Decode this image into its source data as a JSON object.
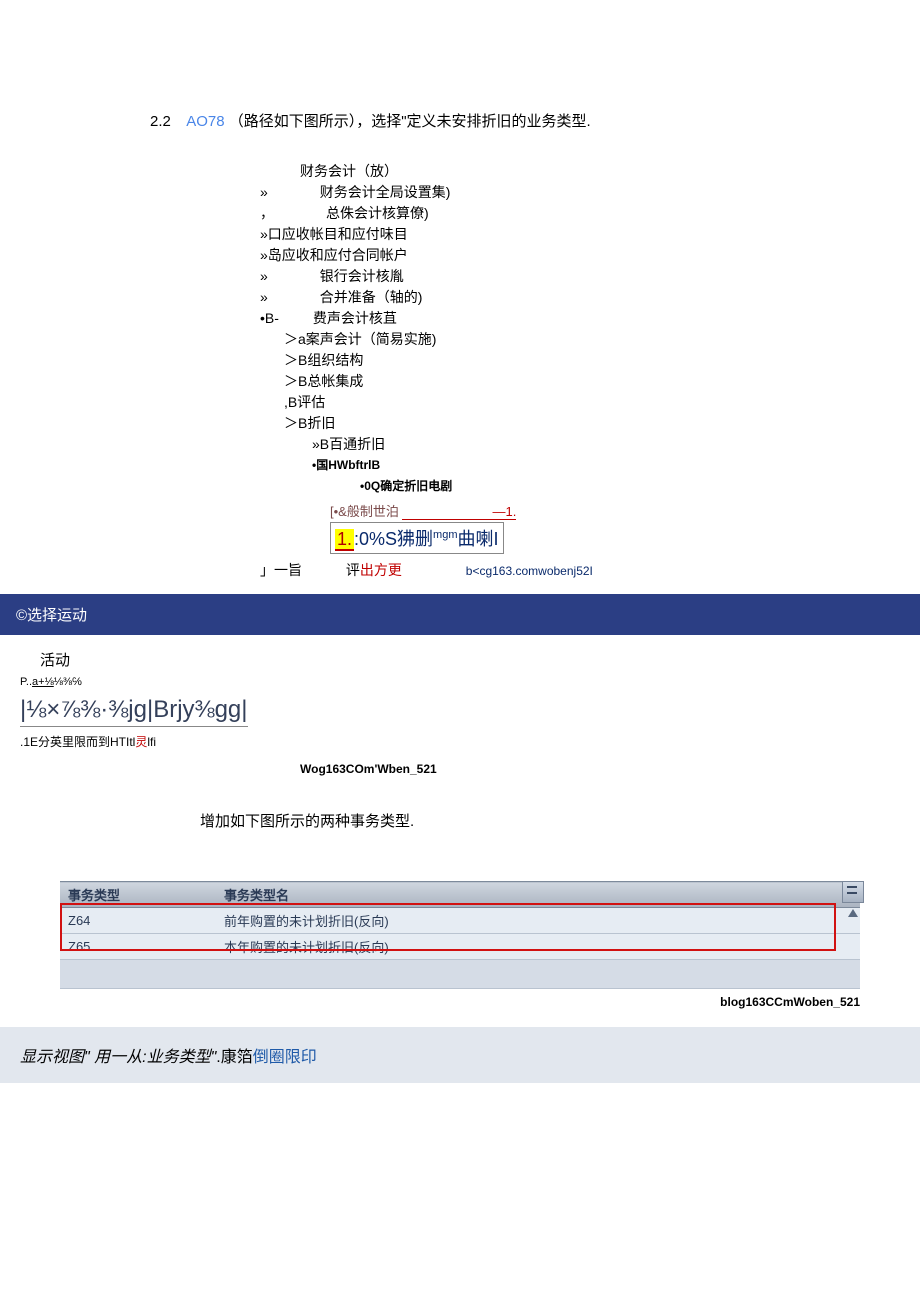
{
  "heading": {
    "num": "2.2",
    "tcode": "AO78",
    "rest": "（路径如下图所示），选择\"定义未安排折旧的业务类型."
  },
  "tree": {
    "r1": "财务会计（放）",
    "r2a": "»",
    "r2b": "财务会计全局设置集)",
    "r3a": "，",
    "r3b": "总侏会计核算僚)",
    "r4": "»口应收帐目和应付味目",
    "r5": "»岛应收和应付合同帐户",
    "r6a": "»",
    "r6b": "银行会计核胤",
    "r7a": "»",
    "r7b": "合并准备（轴的)",
    "r8a": "•B-",
    "r8b": "费声会计核苴",
    "r9": "＞a案声会计（简易实施)",
    "r10": "＞B组织结构",
    "r11": "＞B总帐集成",
    "r12": ",B评估",
    "r13": "＞B折旧",
    "r14": "»B百通折旧",
    "r15": "•国HWbftrlB",
    "r16": "•0Q确定折旧电剧"
  },
  "hb": {
    "l1_left": "[•&般制世泊",
    "l1_right": "—1.",
    "l2_y": "1.",
    "l2_rest": ":0%S狒删",
    "l2_sup": "mgm",
    "l2_tail": "曲喇I"
  },
  "bottomline": {
    "pg": "」一旨",
    "mid_pre": "评",
    "mid_red": "出方更",
    "tail": "b<cg163.comwobenj52I"
  },
  "bluebar": "©选择运动",
  "dlg": {
    "label": "活动",
    "psm_pre": "P..",
    "psm_u": "a+⅛",
    "psm_suf": "⅛⅜℅",
    "large": "|⅛×⅞⅜·⅜jg|Brjy⅜gg|",
    "sub_pre": ".1E分英里限而到HTItl",
    "sub_r": "灵",
    "sub_suf": "lfi",
    "wm": "Wog163COm'Wben_521"
  },
  "para2": "增加如下图所示的两种事务类型.",
  "table": {
    "h1": "事务类型",
    "h2": "事务类型名",
    "rows": [
      {
        "c1": "Z64",
        "c2": "前年购置的未计划折旧(反向)"
      },
      {
        "c1": "Z65",
        "c2": "本年购置的未计划折旧(反向)"
      }
    ]
  },
  "wm2": "blog163CCmWoben_521",
  "viewbar": {
    "it": "显示视图\" 用一从:业务类型\"",
    "pre": ".康箔",
    "blue": "倒圈限印"
  }
}
